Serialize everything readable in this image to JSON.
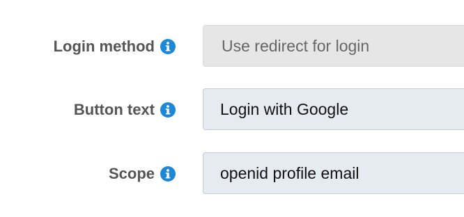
{
  "form": {
    "rows": [
      {
        "label": "Login method",
        "value": "Use redirect for login",
        "kind": "select"
      },
      {
        "label": "Button text",
        "value": "Login with Google",
        "kind": "input"
      },
      {
        "label": "Scope",
        "value": "openid profile email",
        "kind": "input"
      }
    ]
  },
  "icons": {
    "info": "info-icon"
  },
  "colors": {
    "label": "#555555",
    "info_icon": "#1e88d6",
    "select_bg": "#e6e6e6",
    "input_bg": "#e6ebf2"
  }
}
